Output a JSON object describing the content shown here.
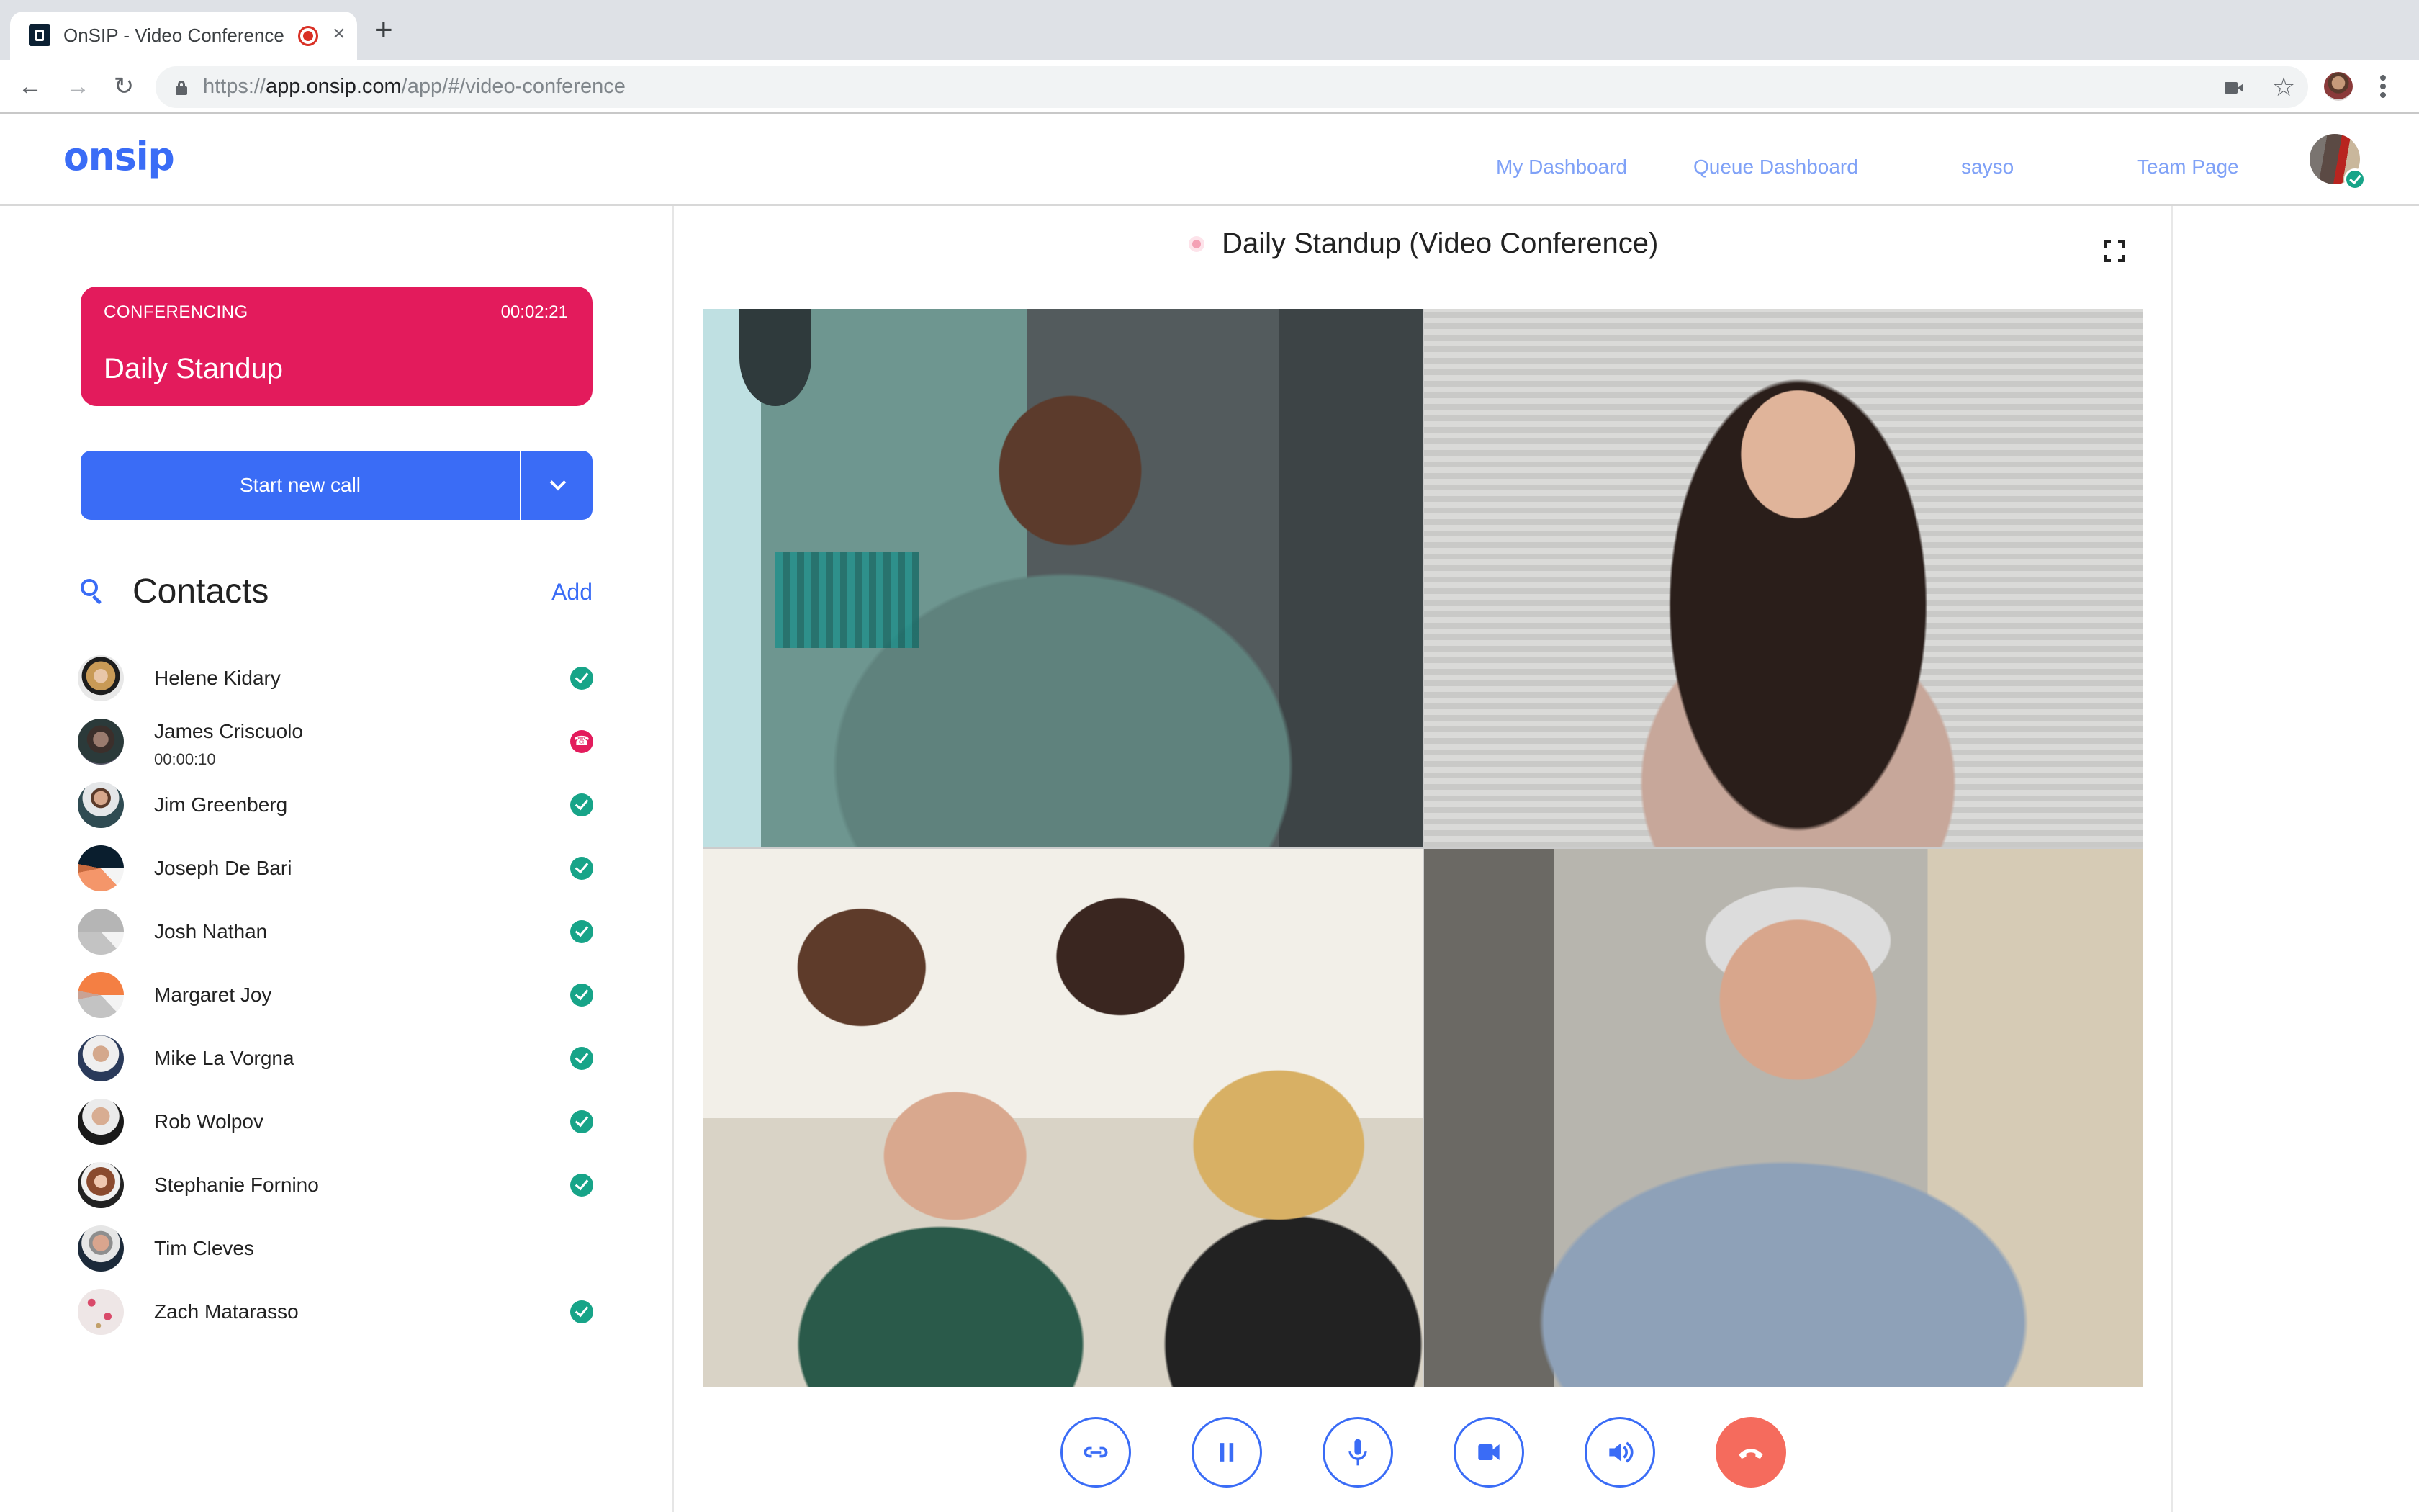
{
  "browser": {
    "tab": {
      "title": "OnSIP - Video Conference",
      "favicon": "onsip-favicon",
      "recording_indicator": "recording-icon",
      "close_glyph": "×"
    },
    "new_tab_glyph": "+",
    "nav": {
      "back_glyph": "←",
      "forward_glyph": "→",
      "reload_glyph": "↻"
    },
    "url": {
      "scheme": "https://",
      "host": "app.onsip.com",
      "path": "/app/#/video-conference"
    },
    "toolbar_icons": [
      "camera-in-use-icon",
      "star-icon",
      "profile-avatar",
      "menu-icon"
    ],
    "star_glyph": "☆"
  },
  "app_header": {
    "logo": "onsip",
    "nav": [
      {
        "label": "My Dashboard"
      },
      {
        "label": "Queue Dashboard"
      },
      {
        "label": "sayso"
      },
      {
        "label": "Team Page"
      }
    ],
    "user_status": "available"
  },
  "sidebar": {
    "active_call": {
      "status_label": "CONFERENCING",
      "duration": "00:02:21",
      "name": "Daily Standup",
      "color": "#e31b5c"
    },
    "start_call": {
      "label": "Start new call",
      "dropdown_icon": "chevron-down-icon",
      "color": "#3a6cf6"
    },
    "contacts": {
      "title": "Contacts",
      "add_label": "Add",
      "items": [
        {
          "name": "Helene Kidary",
          "sub": "",
          "status": "available",
          "avatar": "photo-helene"
        },
        {
          "name": "James Criscuolo",
          "sub": "00:00:10",
          "status": "on-call",
          "avatar": "photo-james"
        },
        {
          "name": "Jim Greenberg",
          "sub": "",
          "status": "available",
          "avatar": "photo-jim"
        },
        {
          "name": "Joseph De Bari",
          "sub": "",
          "status": "available",
          "avatar": "joseph"
        },
        {
          "name": "Josh Nathan",
          "sub": "",
          "status": "available",
          "avatar": "josh"
        },
        {
          "name": "Margaret Joy",
          "sub": "",
          "status": "available",
          "avatar": "margaret"
        },
        {
          "name": "Mike La Vorgna",
          "sub": "",
          "status": "available",
          "avatar": "photo-mike"
        },
        {
          "name": "Rob Wolpov",
          "sub": "",
          "status": "available",
          "avatar": "photo-rob"
        },
        {
          "name": "Stephanie Fornino",
          "sub": "",
          "status": "available",
          "avatar": "photo-stephanie"
        },
        {
          "name": "Tim Cleves",
          "sub": "",
          "status": "none",
          "avatar": "photo-tim"
        },
        {
          "name": "Zach Matarasso",
          "sub": "",
          "status": "available",
          "avatar": "zach"
        }
      ]
    }
  },
  "conference": {
    "title": "Daily Standup (Video Conference)",
    "fullscreen_icon": "fullscreen-icon",
    "participants": [
      {
        "tile": "participant-video-1",
        "description": "Man in teal shirt in office"
      },
      {
        "tile": "participant-video-2",
        "description": "Woman with long dark hair"
      },
      {
        "tile": "participant-video-3",
        "description": "Group of four women"
      },
      {
        "tile": "participant-video-4",
        "description": "Older man with white beard gesturing"
      }
    ],
    "controls": [
      {
        "name": "copy-link-button",
        "icon": "link-icon"
      },
      {
        "name": "hold-button",
        "icon": "pause-icon"
      },
      {
        "name": "mute-button",
        "icon": "microphone-icon"
      },
      {
        "name": "video-button",
        "icon": "video-camera-icon"
      },
      {
        "name": "speaker-button",
        "icon": "speaker-icon"
      },
      {
        "name": "hang-up-button",
        "icon": "hang-up-icon"
      }
    ],
    "colors": {
      "accent": "#3a6cf6",
      "hangup": "#f56b5d",
      "available": "#17a488"
    }
  }
}
